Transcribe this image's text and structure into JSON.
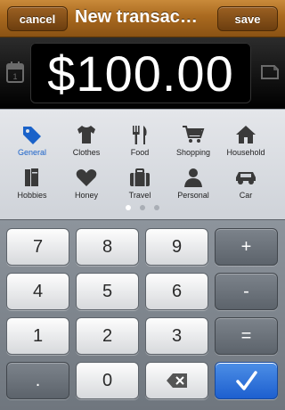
{
  "nav": {
    "cancel_label": "cancel",
    "title": "New transac…",
    "save_label": "save"
  },
  "display": {
    "amount": "$100.00"
  },
  "categories": [
    {
      "label": "General",
      "icon": "tag-icon",
      "selected": true
    },
    {
      "label": "Clothes",
      "icon": "shirt-icon"
    },
    {
      "label": "Food",
      "icon": "cutlery-icon"
    },
    {
      "label": "Shopping",
      "icon": "cart-icon"
    },
    {
      "label": "Household",
      "icon": "house-icon"
    },
    {
      "label": "Hobbies",
      "icon": "books-icon"
    },
    {
      "label": "Honey",
      "icon": "heart-icon"
    },
    {
      "label": "Travel",
      "icon": "suitcase-icon"
    },
    {
      "label": "Personal",
      "icon": "person-icon"
    },
    {
      "label": "Car",
      "icon": "car-icon"
    }
  ],
  "page_indicator": {
    "pages": 3,
    "current": 1
  },
  "keypad": {
    "k7": "7",
    "k8": "8",
    "k9": "9",
    "plus": "+",
    "k4": "4",
    "k5": "5",
    "k6": "6",
    "minus": "-",
    "k1": "1",
    "k2": "2",
    "k3": "3",
    "equals": "=",
    "dot": ".",
    "k0": "0",
    "backspace": "backspace-icon",
    "done": "checkmark-icon"
  },
  "colors": {
    "accent": "#1a62c9",
    "topbar": "#a9691f",
    "done_key": "#1d5fcf"
  }
}
